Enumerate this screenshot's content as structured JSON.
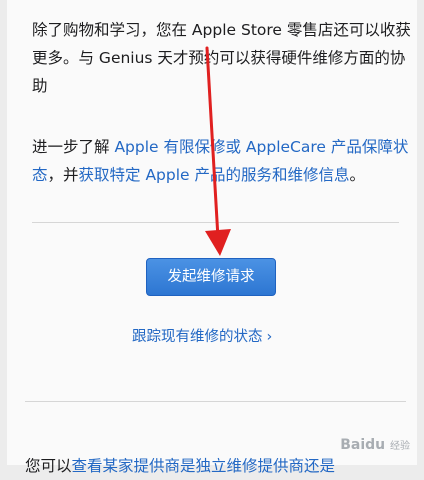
{
  "intro": {
    "text": "除了购物和学习，您在 Apple Store 零售店还可以收获更多。与 Genius 天才预约可以获得硬件维修方面的协助"
  },
  "learn_more": {
    "prefix": "进一步了解 ",
    "link1": "Apple 有限保修或 AppleCare 产品保障状态",
    "middle": "，并",
    "link2": "获取特定 Apple 产品的服务和维修信息",
    "suffix": "。"
  },
  "actions": {
    "start_repair_label": "发起维修请求",
    "track_repair_label": "跟踪现有维修的状态",
    "track_chevron": "›"
  },
  "bottom": {
    "prefix": "您可以",
    "link": "查看某家提供商是独立维修提供商还是"
  },
  "watermark": {
    "brand": "Baidu",
    "sub": "经验"
  },
  "colors": {
    "link": "#2368c4",
    "button": "#2d76d2",
    "arrow": "#e02020"
  }
}
